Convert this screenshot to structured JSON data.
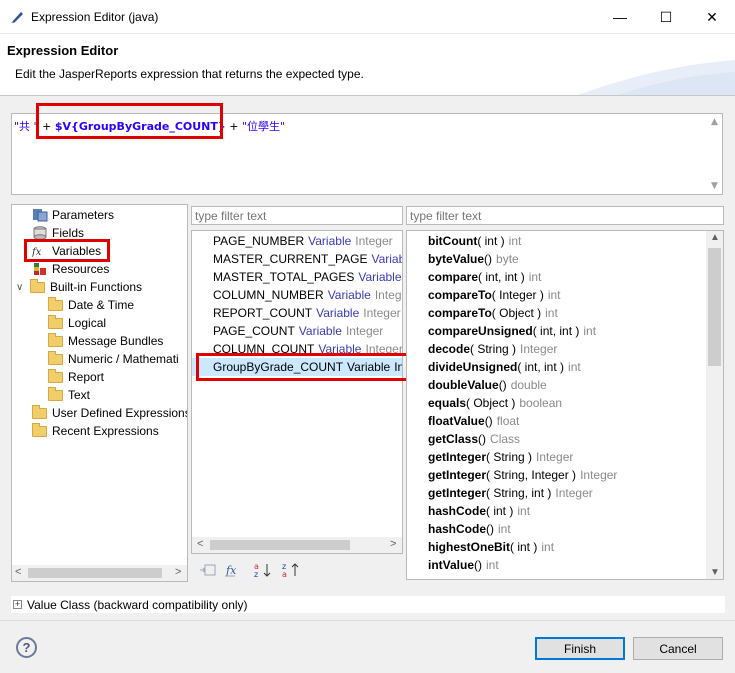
{
  "window": {
    "title": "Expression Editor (java)",
    "controls": {
      "minimize": "—",
      "maximize": "☐",
      "close": "✕"
    }
  },
  "header": {
    "title": "Expression Editor",
    "description": "Edit the JasperReports expression that returns the expected type."
  },
  "expression": {
    "part1": "\"共 \"",
    "op1": " + ",
    "variable": "$V{GroupByGrade_COUNT}",
    "op2": " + ",
    "part2": "\"位學生\""
  },
  "tree": {
    "items": [
      {
        "label": "Parameters",
        "icon": "parameters-icon"
      },
      {
        "label": "Fields",
        "icon": "fields-icon"
      },
      {
        "label": "Variables",
        "icon": "variables-icon"
      },
      {
        "label": "Resources",
        "icon": "resources-icon"
      },
      {
        "label": "Built-in Functions",
        "icon": "folder-icon"
      },
      {
        "label": "Date & Time",
        "icon": "folder-icon"
      },
      {
        "label": "Logical",
        "icon": "folder-icon"
      },
      {
        "label": "Message Bundles",
        "icon": "folder-icon"
      },
      {
        "label": "Numeric / Mathemati",
        "icon": "folder-icon"
      },
      {
        "label": "Report",
        "icon": "folder-icon"
      },
      {
        "label": "Text",
        "icon": "folder-icon"
      },
      {
        "label": "User Defined Expressions",
        "icon": "folder-icon"
      },
      {
        "label": "Recent Expressions",
        "icon": "folder-icon"
      }
    ],
    "expand_symbol": "∨"
  },
  "filters": {
    "variables_placeholder": "type filter text",
    "methods_placeholder": "type filter text"
  },
  "variables": [
    {
      "name": "PAGE_NUMBER",
      "kind": "Variable",
      "type": "Integer"
    },
    {
      "name": "MASTER_CURRENT_PAGE",
      "kind": "Variable",
      "type": "In"
    },
    {
      "name": "MASTER_TOTAL_PAGES",
      "kind": "Variable",
      "type": "Inte"
    },
    {
      "name": "COLUMN_NUMBER",
      "kind": "Variable",
      "type": "Integer"
    },
    {
      "name": "REPORT_COUNT",
      "kind": "Variable",
      "type": "Integer"
    },
    {
      "name": "PAGE_COUNT",
      "kind": "Variable",
      "type": "Integer"
    },
    {
      "name": "COLUMN_COUNT",
      "kind": "Variable",
      "type": "Integer"
    },
    {
      "name": "GroupByGrade_COUNT",
      "kind": "Variable",
      "type": "Inte"
    }
  ],
  "methods": [
    {
      "name": "bitCount",
      "params": "( int )",
      "ret": "int"
    },
    {
      "name": "byteValue",
      "params": "()",
      "ret": "byte"
    },
    {
      "name": "compare",
      "params": "( int, int )",
      "ret": "int"
    },
    {
      "name": "compareTo",
      "params": "( Integer )",
      "ret": "int"
    },
    {
      "name": "compareTo",
      "params": "( Object )",
      "ret": "int"
    },
    {
      "name": "compareUnsigned",
      "params": "( int, int )",
      "ret": "int"
    },
    {
      "name": "decode",
      "params": "( String )",
      "ret": "Integer"
    },
    {
      "name": "divideUnsigned",
      "params": "( int, int )",
      "ret": "int"
    },
    {
      "name": "doubleValue",
      "params": "()",
      "ret": "double"
    },
    {
      "name": "equals",
      "params": "( Object )",
      "ret": "boolean"
    },
    {
      "name": "floatValue",
      "params": "()",
      "ret": "float"
    },
    {
      "name": "getClass",
      "params": "()",
      "ret": "Class"
    },
    {
      "name": "getInteger",
      "params": "( String )",
      "ret": "Integer"
    },
    {
      "name": "getInteger",
      "params": "( String, Integer )",
      "ret": "Integer"
    },
    {
      "name": "getInteger",
      "params": "( String, int )",
      "ret": "Integer"
    },
    {
      "name": "hashCode",
      "params": "( int )",
      "ret": "int"
    },
    {
      "name": "hashCode",
      "params": "()",
      "ret": "int"
    },
    {
      "name": "highestOneBit",
      "params": "( int )",
      "ret": "int"
    },
    {
      "name": "intValue",
      "params": "()",
      "ret": "int"
    }
  ],
  "value_class": {
    "expander": "+",
    "label": "Value Class (backward compatibility only)"
  },
  "footer": {
    "help": "?",
    "finish": "Finish",
    "cancel": "Cancel"
  },
  "colors": {
    "selection": "#cce8ff",
    "highlight_box": "#e00000",
    "accent": "#0078d7"
  }
}
